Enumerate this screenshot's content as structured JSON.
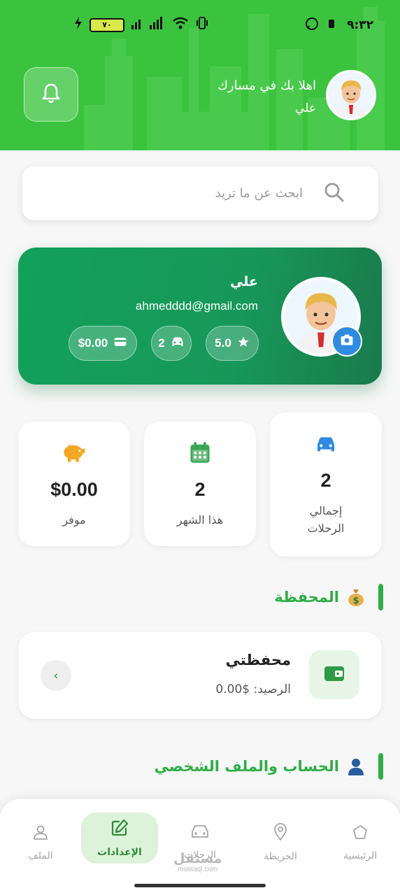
{
  "status_bar": {
    "time": "٩:٣٢",
    "battery": "٧٠",
    "icons": [
      "whatsapp-icon",
      "alarm-icon",
      "vibrate-icon",
      "wifi-icon",
      "signal-icon",
      "charging-icon"
    ]
  },
  "header": {
    "greeting": "اهلا بك في مسارك",
    "user_name": "علي",
    "colors": {
      "background": "#3bc33f"
    }
  },
  "search": {
    "placeholder": "ابحث عن ما تريد"
  },
  "profile_card": {
    "name": "علي",
    "email": "ahmedddd@gmail.com",
    "chips": [
      {
        "value": "5.0",
        "icon": "star-icon"
      },
      {
        "value": "2",
        "icon": "car-icon"
      },
      {
        "value": "$0.00",
        "icon": "wallet-icon"
      }
    ],
    "colors": {
      "gradient_start": "#12a05a",
      "gradient_end": "#1a7a4c",
      "camera": "#2f8be0"
    }
  },
  "stats": [
    {
      "value": "2",
      "label_line1": "إجمالي",
      "label_line2": "الرحلات",
      "icon": "car-icon",
      "color": "#2f8be0"
    },
    {
      "value": "2",
      "label": "هذا الشهر",
      "icon": "calendar-icon",
      "color": "#3aa655"
    },
    {
      "value": "$0.00",
      "label": "موفر",
      "icon": "piggy-bank-icon",
      "color": "#f5a623"
    }
  ],
  "wallet_section": {
    "title": "المحفظة",
    "icon": "money-bag-icon",
    "card_title": "محفظتي",
    "balance": "الرصيد: $0.00",
    "arrow": "‹"
  },
  "account_section": {
    "title": "الحساب والملف الشخصي",
    "icon": "person-icon"
  },
  "bottom_nav": {
    "items": [
      {
        "label": "الرئيسية",
        "icon": "home-icon"
      },
      {
        "label": "الخريطة",
        "icon": "map-pin-icon"
      },
      {
        "label": "الرحلات",
        "icon": "car-icon"
      },
      {
        "label": "الإعدادات",
        "icon": "edit-icon",
        "active": true
      },
      {
        "label": "الملف",
        "icon": "user-icon"
      }
    ],
    "active_color": "#2e8b3a"
  },
  "watermark": {
    "line1": "مستقل",
    "line2": "mostaql.com"
  }
}
